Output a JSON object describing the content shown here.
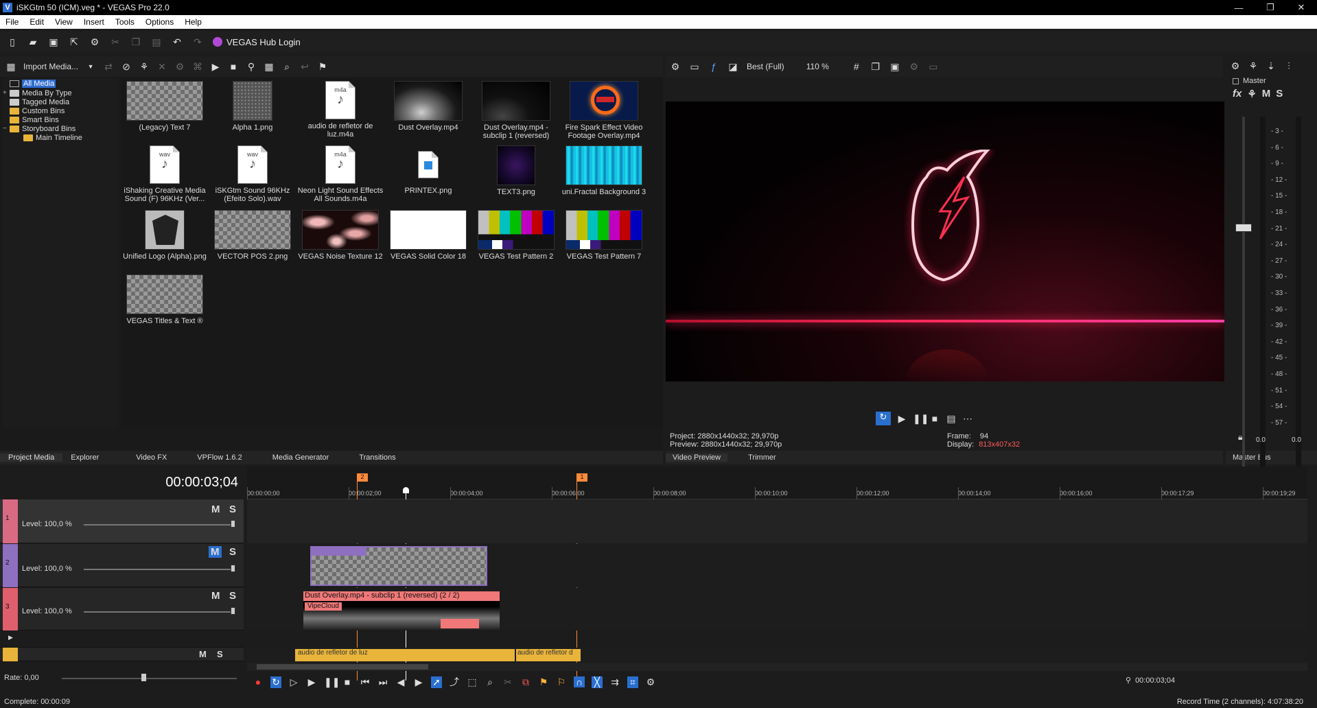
{
  "window": {
    "title": "iSKGtm 50 (ICM).veg * - VEGAS Pro 22.0",
    "app_icon": "V",
    "controls": [
      "—",
      "❐",
      "✕"
    ]
  },
  "menu": [
    "File",
    "Edit",
    "View",
    "Insert",
    "Tools",
    "Options",
    "Help"
  ],
  "toolbar": {
    "hub_login": "VEGAS Hub Login"
  },
  "media": {
    "import_label": "Import Media...",
    "tree": [
      {
        "label": "All Media",
        "selected": true
      },
      {
        "label": "Media By Type",
        "expander": "+"
      },
      {
        "label": "Tagged Media"
      },
      {
        "label": "Custom Bins"
      },
      {
        "label": "Smart Bins"
      },
      {
        "label": "Storyboard Bins",
        "expander": "−"
      },
      {
        "label": "Main Timeline"
      }
    ],
    "items": [
      {
        "label": "(Legacy) Text 7",
        "thumb": "checker"
      },
      {
        "label": "Alpha 1.png",
        "thumb": "alpha"
      },
      {
        "label": "audio de refletor de luz.m4a",
        "thumb": "doc",
        "ext": "m4a"
      },
      {
        "label": "Dust Overlay.mp4",
        "thumb": "dust"
      },
      {
        "label": "Dust Overlay.mp4 - subclip 1 (reversed)",
        "thumb": "dark"
      },
      {
        "label": "Fire Spark Effect Video Footage Overlay.mp4",
        "thumb": "fire"
      },
      {
        "label": "iShaking Creative Media Sound (F) 96KHz (Ver...",
        "thumb": "doc",
        "ext": "wav"
      },
      {
        "label": "iSKGtm Sound 96KHz (Efeito Solo).wav",
        "thumb": "doc",
        "ext": "wav"
      },
      {
        "label": "Neon Light Sound Effects All Sounds.m4a",
        "thumb": "doc",
        "ext": "m4a"
      },
      {
        "label": "PRINTEX.png",
        "thumb": "png"
      },
      {
        "label": "TEXT3.png",
        "thumb": "text3"
      },
      {
        "label": "uni.Fractal Background 3",
        "thumb": "fractal"
      },
      {
        "label": "Unified Logo (Alpha).png",
        "thumb": "wolf"
      },
      {
        "label": "VECTOR POS 2.png",
        "thumb": "checker"
      },
      {
        "label": "VEGAS Noise Texture 12",
        "thumb": "noise"
      },
      {
        "label": "VEGAS Solid Color 18",
        "thumb": "white"
      },
      {
        "label": "VEGAS Test Pattern 2",
        "thumb": "bars"
      },
      {
        "label": "VEGAS Test Pattern 7",
        "thumb": "bars"
      },
      {
        "label": "VEGAS Titles & Text ®",
        "thumb": "checker"
      }
    ]
  },
  "bottom_tabs_left": [
    "Project Media",
    "Explorer",
    "Video FX",
    "VPFlow 1.6.2",
    "Media Generator",
    "Transitions"
  ],
  "bottom_tabs_mid": [
    "Video Preview",
    "Trimmer"
  ],
  "bottom_tabs_right": [
    "Master Bus"
  ],
  "preview": {
    "quality": "Best (Full)",
    "zoom": "110 %",
    "project_label": "Project:",
    "project_value": "2880x1440x32; 29,970p",
    "preview_label": "Preview:",
    "preview_value": "2880x1440x32; 29,970p",
    "frame_label": "Frame:",
    "frame_value": "94",
    "display_label": "Display:",
    "display_value": "813x407x32"
  },
  "master": {
    "label": "Master",
    "fx": "fx",
    "m": "M",
    "s": "S",
    "scale": [
      "3",
      "6",
      "9",
      "12",
      "15",
      "18",
      "21",
      "24",
      "27",
      "30",
      "33",
      "36",
      "39",
      "42",
      "45",
      "48",
      "51",
      "54",
      "57"
    ],
    "left_db": "0.0",
    "right_db": "0.0"
  },
  "timeline": {
    "timecode": "00:00:03;04",
    "ruler": [
      "00:00:00;00",
      "00:00:02;00",
      "00:00:04;00",
      "00:00:06;00",
      "00:00:08;00",
      "00:00:10;00",
      "00:00:12;00",
      "00:00:14;00",
      "00:00:16;00",
      "00:00:17;29",
      "00:00:19;29"
    ],
    "marker_2": "2",
    "marker_1": "1",
    "tracks": [
      {
        "num": "1",
        "level": "Level: 100,0 %",
        "color": "#d96a84"
      },
      {
        "num": "2",
        "level": "Level: 100,0 %",
        "color": "#8f6fc0"
      },
      {
        "num": "3",
        "level": "Level: 100,0 %",
        "color": "#e05f6d"
      }
    ],
    "m_label": "M",
    "s_label": "S",
    "clip_dust": "Dust Overlay.mp4 - subclip 1 (reversed)   (2 / 2)",
    "clip_fx": "VipeCloud",
    "audio_clip_1": "audio de refletor de luz",
    "audio_clip_2": "audio de refletor d",
    "rate": "Rate: 0,00",
    "cursor_time": "00:00:03;04"
  },
  "status": {
    "left": "Complete: 00:00:09",
    "right": "Record Time (2 channels): 4:07:38:20"
  }
}
